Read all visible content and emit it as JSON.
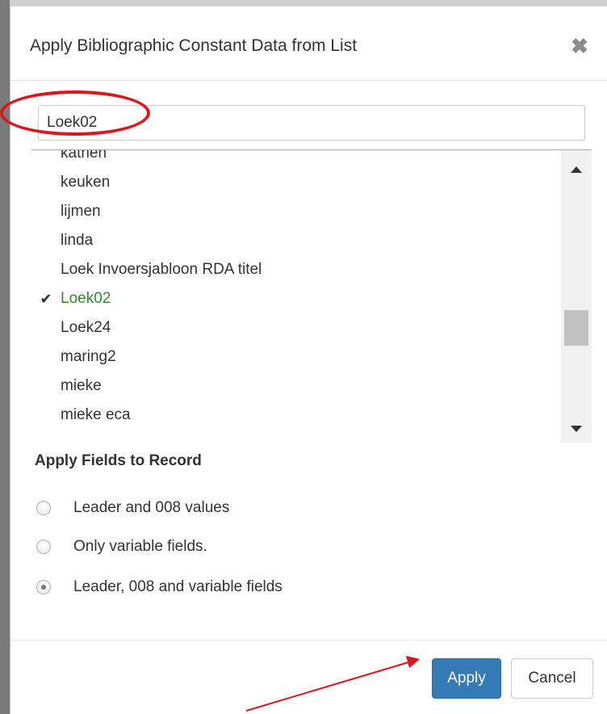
{
  "dialog": {
    "title": "Apply Bibliographic Constant Data from List",
    "close_icon": "close-icon"
  },
  "search": {
    "value": "Loek02"
  },
  "list": {
    "items": [
      {
        "label": "katrien",
        "selected": false
      },
      {
        "label": "keuken",
        "selected": false
      },
      {
        "label": "lijmen",
        "selected": false
      },
      {
        "label": "linda",
        "selected": false
      },
      {
        "label": "Loek Invoersjabloon RDA titel",
        "selected": false
      },
      {
        "label": "Loek02",
        "selected": true
      },
      {
        "label": "Loek24",
        "selected": false
      },
      {
        "label": "maring2",
        "selected": false
      },
      {
        "label": "mieke",
        "selected": false
      },
      {
        "label": "mieke eca",
        "selected": false
      }
    ],
    "check_icon": "✔",
    "selected_color": "#2e8b2e"
  },
  "apply_fields": {
    "heading": "Apply Fields to Record",
    "options": [
      {
        "label": "Leader and 008 values",
        "checked": false
      },
      {
        "label": "Only variable fields.",
        "checked": false
      },
      {
        "label": "Leader, 008 and variable fields",
        "checked": true
      }
    ]
  },
  "footer": {
    "apply_label": "Apply",
    "cancel_label": "Cancel"
  },
  "colors": {
    "primary": "#337ab7",
    "annotation": "#e0141c"
  }
}
